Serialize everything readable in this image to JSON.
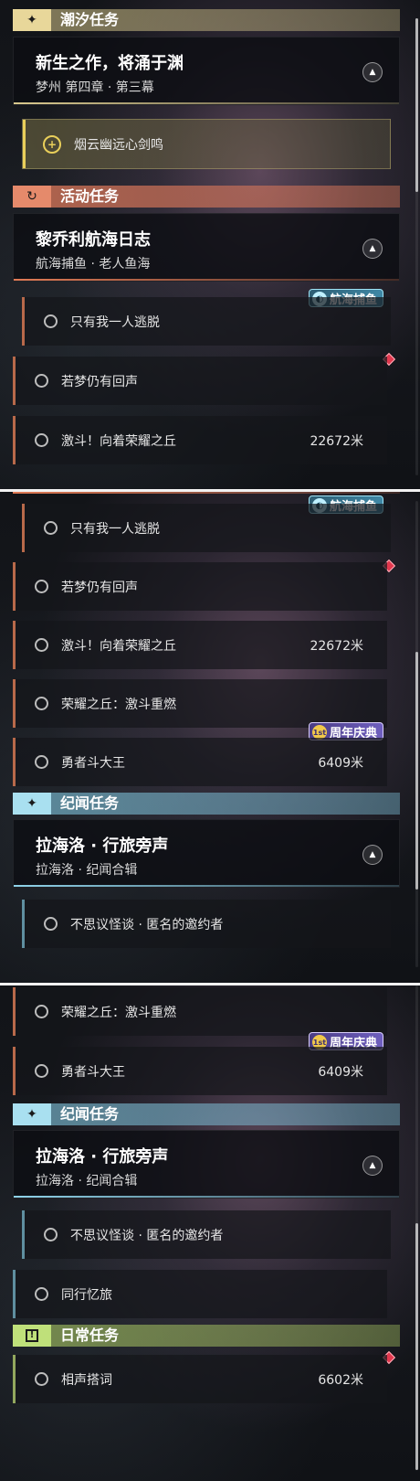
{
  "icons": {
    "tide": "sparkle-icon",
    "event": "refresh-icon",
    "lore": "sparkle-icon",
    "daily": "exclamation-icon",
    "tracked": "plus-circle-icon",
    "collapse": "triangle-up-icon"
  },
  "panel1": {
    "cat_tide": "潮汐任务",
    "tide_quest": {
      "title": "新生之作，将涌于渊",
      "subtitle": "梦州 第四章 · 第三幕"
    },
    "tracked_task": "烟云幽远心剑鸣",
    "cat_event": "活动任务",
    "event_quest": {
      "title": "黎乔利航海日志",
      "subtitle": "航海捕鱼 · 老人鱼海"
    },
    "badge_fishing": "航海捕鱼",
    "tasks": [
      {
        "name": "只有我一人逃脱",
        "distance": ""
      },
      {
        "name": "若梦仍有回声",
        "distance": ""
      },
      {
        "name": "激斗！向着荣耀之丘",
        "distance": "22672米"
      }
    ]
  },
  "panel2": {
    "badge_fishing": "航海捕鱼",
    "badge_anniversary": "周年庆典",
    "tasks": [
      {
        "name": "只有我一人逃脱",
        "distance": ""
      },
      {
        "name": "若梦仍有回声",
        "distance": ""
      },
      {
        "name": "激斗！向着荣耀之丘",
        "distance": "22672米"
      },
      {
        "name": "荣耀之丘：激斗重燃",
        "distance": ""
      },
      {
        "name": "勇者斗大王",
        "distance": "6409米"
      }
    ],
    "cat_lore": "纪闻任务",
    "lore_quest": {
      "title": "拉海洛 · 行旅旁声",
      "subtitle": "拉海洛 · 纪闻合辑"
    },
    "lore_task": "不思议怪谈 · 匿名的邀约者"
  },
  "panel3": {
    "badge_anniversary": "周年庆典",
    "tasks": [
      {
        "name": "荣耀之丘：激斗重燃",
        "distance": ""
      },
      {
        "name": "勇者斗大王",
        "distance": "6409米"
      }
    ],
    "cat_lore": "纪闻任务",
    "lore_quest": {
      "title": "拉海洛 · 行旅旁声",
      "subtitle": "拉海洛 · 纪闻合辑"
    },
    "lore_tasks": [
      {
        "name": "不思议怪谈 · 匿名的邀约者"
      },
      {
        "name": "同行忆旅"
      }
    ],
    "cat_daily": "日常任务",
    "daily_task": {
      "name": "相声搭词",
      "distance": "6602米"
    }
  }
}
